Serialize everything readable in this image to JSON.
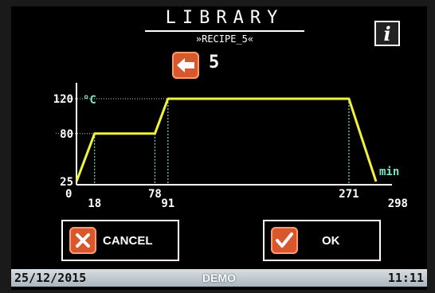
{
  "header": {
    "title": "LIBRARY",
    "subtitle": "»RECIPE_5«",
    "info_icon": "info-icon",
    "back_icon": "arrow-left-icon",
    "recipe_number": "5"
  },
  "chart_data": {
    "type": "line",
    "x": [
      0,
      18,
      78,
      91,
      271,
      298
    ],
    "y": [
      25,
      80,
      80,
      120,
      120,
      25
    ],
    "x_ticks": [
      "0",
      "18",
      "78",
      "91",
      "271",
      "298"
    ],
    "y_ticks": [
      "25",
      "80",
      "120"
    ],
    "ylabel": "°C",
    "xlabel": "min",
    "line_color": "#f2f23a",
    "marker_color": "#7fe0c8",
    "axis_color": "#ffffff"
  },
  "buttons": {
    "cancel_label": "CANCEL",
    "cancel_icon": "x-icon",
    "ok_label": "OK",
    "ok_icon": "check-icon"
  },
  "status_bar": {
    "date": "25/12/2015",
    "mode": "DEMO",
    "time": "11:11"
  }
}
